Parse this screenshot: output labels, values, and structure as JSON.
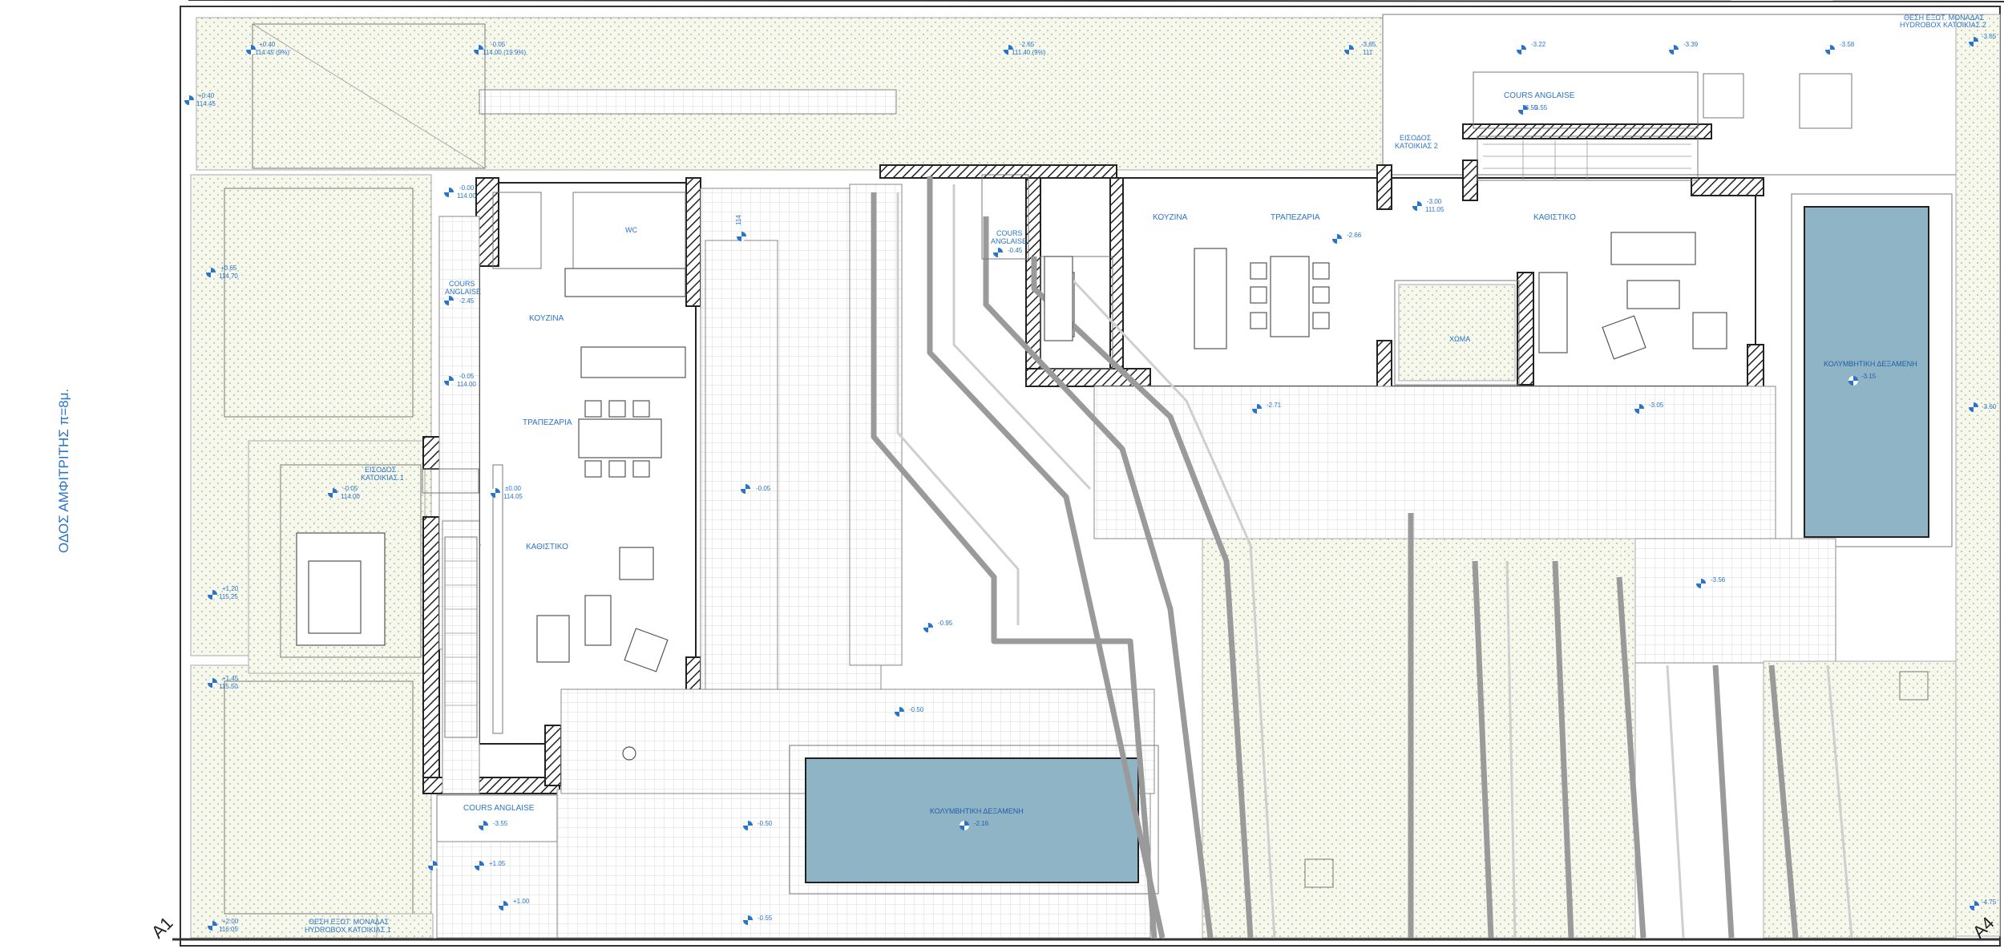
{
  "street": {
    "label": "ΟΔΟΣ ΑΜΦΙΤΡΙΤΗΣ π=8μ."
  },
  "axes": {
    "left": "A1",
    "right": "A4"
  },
  "colors": {
    "label_blue": "#2a74c8",
    "pool_fill": "#8fb4c6",
    "wall_hatch": "#222222"
  },
  "rooms": {
    "wc": "WC",
    "kitchen_1": "ΚΟΥΖΙΝΑ",
    "dining_1": "ΤΡΑΠΕΖΑΡΙΑ",
    "living_1": "ΚΑΘΙΣΤΙΚΟ",
    "kitchen_2": "ΚΟΥΖΙΝΑ",
    "dining_2": "ΤΡΑΠΕΖΑΡΙΑ",
    "living_2": "ΚΑΘΙΣΤΙΚΟ",
    "soil": "ΧΩΜΑ",
    "cours_top": "COURS ANGLAISE",
    "cours_mid1a": "COURS",
    "cours_mid1b": "ANGLAISE",
    "cours_mid2a": "COURS",
    "cours_mid2b": "ANGLAISE",
    "cours_bottom": "COURS ANGLAISE",
    "entrance_1a": "ΕΙΣΟΔΟΣ",
    "entrance_1b": "ΚΑΤΟΙΚΙΑΣ 1",
    "entrance_2a": "ΕΙΣΟΔΟΣ",
    "entrance_2b": "ΚΑΤΟΙΚΙΑΣ 2",
    "pool_label": "ΚΟΛΥΜΒΗΤΙΚΗ ΔΕΞΑΜΕΝΗ",
    "pool_label_right": "ΚΟΛΥΜΒΗΤΙΚΗ ΔΕΞΑΜΕΝΗ",
    "hydrobox_1a": "ΘΕΣΗ ΕΞΩΤ. ΜΟΝΑΔΑΣ",
    "hydrobox_1b": "HYDROBOX ΚΑΤΟΙΚΙΑΣ 1",
    "hydrobox_2a": "ΘΕΣΗ ΕΞΩΤ. ΜΟΝΑΔΑΣ",
    "hydrobox_2b": "HYDROBOX ΚΑΤΟΙΚΙΑΣ 2"
  },
  "levels": {
    "l1a": "+0.40",
    "l1b": "114.45 (9%)",
    "l2a": "-0.05",
    "l2b": "114.00 (19.9%)",
    "l3a": "-2.65",
    "l3b": "111.40 (9%)",
    "l4a": "-3.65",
    "l4b": "111",
    "l5": "-3.22",
    "l6": "-3.39",
    "l7": "-3.58",
    "l8": "-3.65",
    "l9a": "+0.40",
    "l9b": "114.45",
    "l10a": "+0.65",
    "l10b": "114.70",
    "l11a": "-0.00",
    "l11b": "114.00",
    "l12": "-2.45",
    "l13a": "-0.05",
    "l13b": "114.00",
    "l14a": "-0.05",
    "l14b": "114.00",
    "l15a": "±0.00",
    "l15b": "114.05",
    "l16": "-0.05",
    "l17a": "+1.20",
    "l17b": "115.25",
    "l18a": "+1.45",
    "l18b": "115.50",
    "l19a": "+2.00",
    "l19b": "116.05",
    "l20": "-0.45",
    "l21a": "-3.00",
    "l21b": "111.05",
    "l22": "-2.66",
    "l23": "-3.55",
    "l24": "-2.71",
    "l25": "-3.05",
    "l26": "-3.60",
    "l27": "-3.56",
    "l28": "-0.95",
    "l29": "-0.50",
    "l30": "-0.50",
    "l31": "-2.16",
    "l32": "-3.15",
    "l33": "-3.55",
    "l34": "-3.55",
    "l35": "+1.05",
    "l36": "+1.00",
    "l37": "-0.55",
    "l38": "-4.75",
    "l39": "114"
  }
}
